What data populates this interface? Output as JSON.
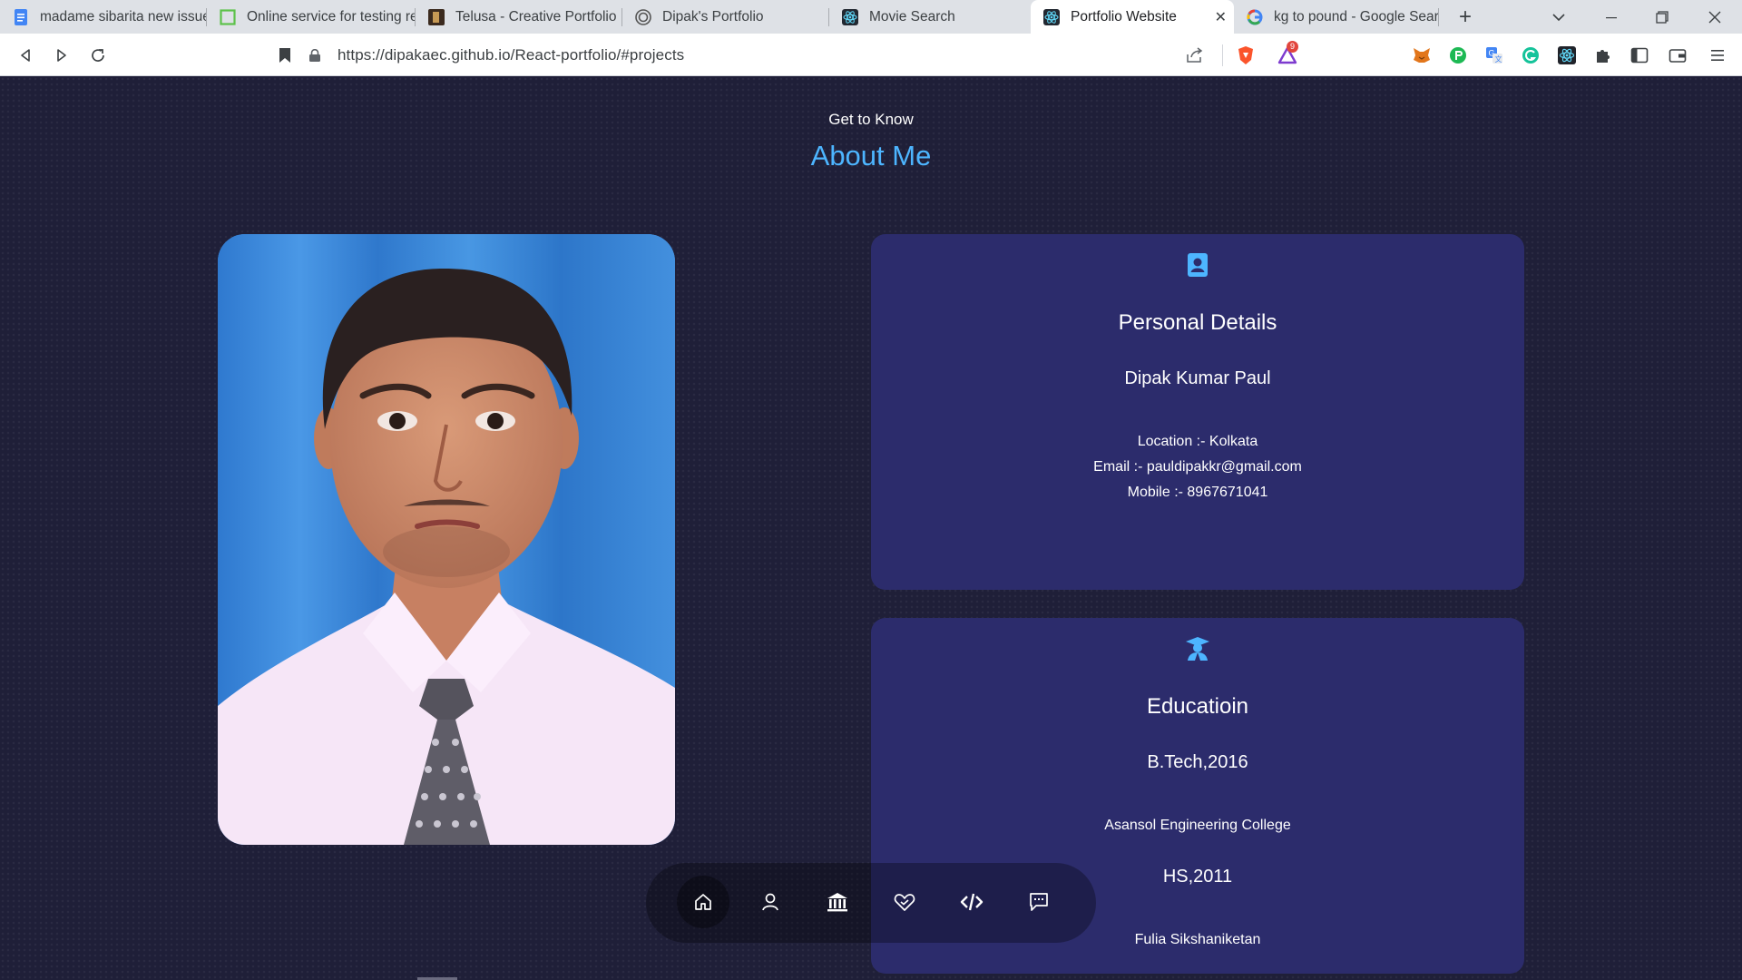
{
  "browser": {
    "tabs": [
      {
        "title": "madame sibarita new issue",
        "icon": "google-docs-icon"
      },
      {
        "title": "Online service for testing re",
        "icon": "test-site-icon"
      },
      {
        "title": "Telusa - Creative Portfolio H",
        "icon": "telusa-icon"
      },
      {
        "title": "Dipak's Portfolio",
        "icon": "portfolio-icon"
      },
      {
        "title": "Movie Search",
        "icon": "react-icon"
      },
      {
        "title": "Portfolio Website",
        "icon": "react-icon",
        "active": true
      },
      {
        "title": "kg to pound - Google Sear",
        "icon": "google-icon"
      }
    ],
    "new_tab": "+",
    "url": "https://dipakaec.github.io/React-portfolio/#projects",
    "notification_count": "9"
  },
  "page": {
    "subtitle": "Get to Know",
    "title": "About Me",
    "personal": {
      "heading": "Personal Details",
      "name": "Dipak Kumar Paul",
      "location": "Location :- Kolkata",
      "email": "Email :- pauldipakkr@gmail.com",
      "mobile": "Mobile :- 8967671041"
    },
    "education": {
      "heading": "Educatioin",
      "degree1": "B.Tech,2016",
      "college1": "Asansol Engineering College",
      "degree2": "HS,2011",
      "school2": "Fulia Sikshaniketan"
    },
    "dock": [
      {
        "name": "home",
        "active": true
      },
      {
        "name": "about"
      },
      {
        "name": "education"
      },
      {
        "name": "services"
      },
      {
        "name": "projects"
      },
      {
        "name": "contact"
      }
    ]
  },
  "colors": {
    "accent": "#4db5ff",
    "card": "#2c2c6c",
    "background": "#1f1f38"
  }
}
